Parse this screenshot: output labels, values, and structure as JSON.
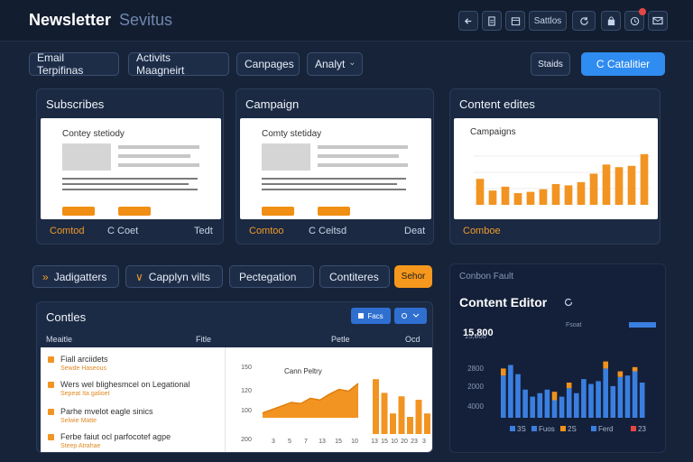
{
  "header": {
    "title": "Newsletter",
    "subtitle": "Sevitus",
    "icon_buttons": [
      {
        "icon": "back-arrow-icon"
      },
      {
        "icon": "document-icon"
      },
      {
        "icon": "calendar-icon"
      }
    ],
    "status_label": "Sattlos",
    "icon_buttons_right": [
      {
        "icon": "refresh-icon"
      },
      {
        "icon": "bag-icon"
      },
      {
        "icon": "clock-icon"
      },
      {
        "icon": "mail-icon"
      }
    ]
  },
  "nav": {
    "items": [
      "Email Terpifinas",
      "Activits Maagneirt",
      "Canpages"
    ],
    "dropdown": "Analyt",
    "secondary_button": "Staids",
    "primary_button": "C Catalitier"
  },
  "cards": [
    {
      "title": "Subscribes",
      "preview_title": "Contey stetiody",
      "footer_left": "Comtod",
      "footer_mid": "C Coet",
      "footer_right": "Tedt"
    },
    {
      "title": "Campaign",
      "preview_title": "Comty stetiday",
      "footer_left": "Comtoo",
      "footer_mid": "C Ceitsd",
      "footer_right": "Deat"
    },
    {
      "title": "Content edites",
      "chart_title": "Campaigns",
      "footer_left": "Comboe"
    }
  ],
  "tabs": {
    "items": [
      "Jadigatters",
      "Capplyn vilts",
      "Pectegation",
      "Contiteres"
    ],
    "action_button": "Sehor"
  },
  "contents": {
    "title": "Contles",
    "button_label": "Facs",
    "columns": [
      "Meaitle",
      "Fitle",
      "Petle",
      "Ocd"
    ],
    "rows": [
      {
        "title": "Fiall arciidets",
        "sub": "Sewde Haseous"
      },
      {
        "title": "Wers wel blighesmcel on Legational",
        "sub": "Sepeat Ita galioet"
      },
      {
        "title": "Parhe mvelot eagle sinics",
        "sub": "Selwie Matte"
      },
      {
        "title": "Ferbe faiut ocl parfocotef agpe",
        "sub": "Steep Atrahae"
      }
    ],
    "area_chart_title": "Cann Peltry",
    "y_ticks": [
      "150",
      "120",
      "100",
      "200"
    ],
    "x_ticks": [
      "3",
      "5",
      "7",
      "13",
      "15",
      "10"
    ],
    "bar_ticks": [
      "13",
      "15",
      "10",
      "20",
      "23",
      "3"
    ]
  },
  "editor": {
    "eyebrow": "Conbon Fault",
    "title": "Content Editor",
    "stat": "15,800",
    "legend_label": "Fsoat",
    "y_ticks": [
      "15,800",
      "2800",
      "2000",
      "4000"
    ],
    "legend": [
      {
        "label": "3S",
        "color": "#3a7fe0"
      },
      {
        "label": "Fuos",
        "color": "#3a7fe0"
      },
      {
        "label": "2S",
        "color": "#f0921d"
      },
      {
        "label": "Ferd",
        "color": "#3a7fe0"
      },
      {
        "label": "23",
        "color": "#e54646"
      }
    ]
  },
  "colors": {
    "background": "#172338",
    "accent_blue": "#2f8cf0",
    "accent_orange": "#f6981d"
  },
  "chart_data": [
    {
      "type": "bar",
      "title": "Campaigns",
      "values": [
        40,
        22,
        28,
        18,
        20,
        24,
        32,
        30,
        35,
        48,
        62,
        58,
        60,
        78
      ],
      "ylim": [
        0,
        100
      ]
    },
    {
      "type": "area",
      "title": "Cann Peltry",
      "y_ticks": [
        "150",
        "120",
        "100",
        "200"
      ],
      "x_ticks": [
        "3",
        "5",
        "7",
        "13",
        "15",
        "10"
      ],
      "values": [
        8,
        14,
        20,
        26,
        24,
        33,
        30,
        40,
        48,
        45,
        58
      ]
    },
    {
      "type": "bar",
      "x_ticks": [
        "13",
        "15",
        "10",
        "20",
        "23",
        "3"
      ],
      "values": [
        80,
        60,
        30,
        55,
        25,
        50,
        30,
        27
      ]
    },
    {
      "type": "bar",
      "title": "Content Editor",
      "y_ticks": [
        "15,800",
        "2800",
        "2000",
        "4000"
      ],
      "series": [
        {
          "name": "Fuos",
          "values": [
            60,
            75,
            62,
            40,
            30,
            35,
            40,
            25,
            30,
            42,
            35,
            55,
            48,
            52,
            70,
            45,
            58,
            60,
            66,
            50
          ]
        },
        {
          "name": "2S",
          "values": [
            10,
            0,
            0,
            0,
            0,
            0,
            0,
            12,
            0,
            8,
            0,
            0,
            0,
            0,
            10,
            0,
            8,
            0,
            6,
            0
          ]
        }
      ]
    }
  ]
}
